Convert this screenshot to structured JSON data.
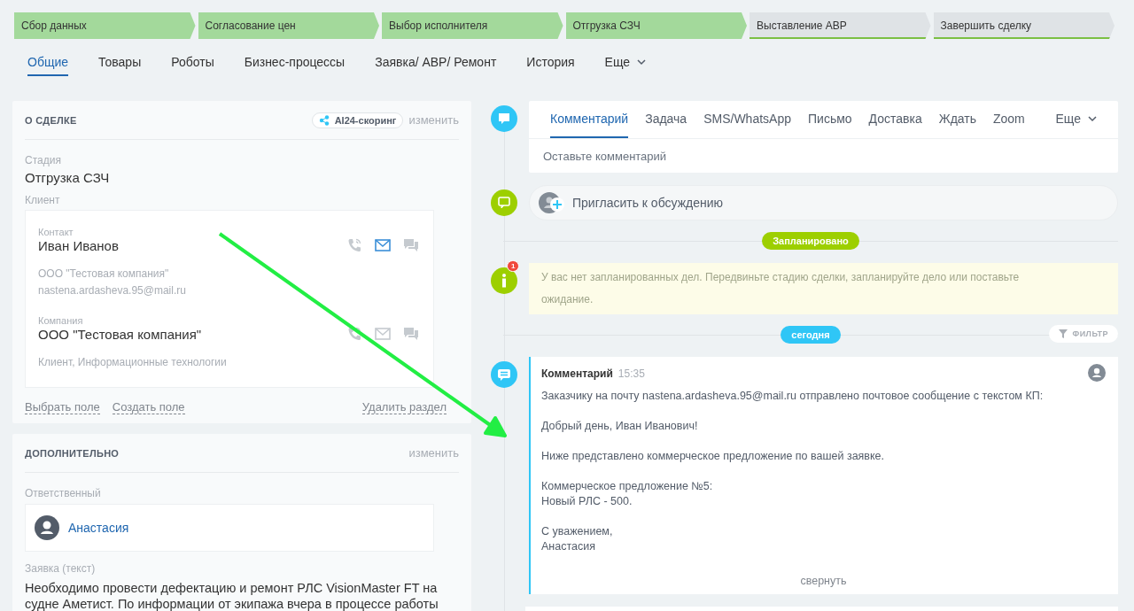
{
  "stages": [
    {
      "label": "Сбор данных",
      "done": true
    },
    {
      "label": "Согласование цен",
      "done": true
    },
    {
      "label": "Выбор исполнителя",
      "done": true
    },
    {
      "label": "Отгрузка СЗЧ",
      "done": true
    },
    {
      "label": "Выставление АВР",
      "done": false
    },
    {
      "label": "Завершить сделку",
      "done": false
    }
  ],
  "tabs": [
    {
      "label": "Общие",
      "selected": true
    },
    {
      "label": "Товары",
      "selected": false
    },
    {
      "label": "Роботы",
      "selected": false
    },
    {
      "label": "Бизнес-процессы",
      "selected": false
    },
    {
      "label": "Заявка/ АВР/ Ремонт",
      "selected": false
    },
    {
      "label": "История",
      "selected": false
    }
  ],
  "tabs_more": "Еще",
  "deal_card": {
    "title": "О СДЕЛКЕ",
    "badge": "AI24-скоринг",
    "edit": "изменить",
    "stage_label": "Стадия",
    "stage_value": "Отгрузка СЗЧ",
    "client_label": "Клиент",
    "clients": [
      {
        "label": "Контакт",
        "name": "Иван Иванов",
        "details": [
          "ООО \"Тестовая компания\"",
          "nastena.ardasheva.95@mail.ru"
        ],
        "email_active": true
      },
      {
        "label": "Компания",
        "name": "ООО \"Тестовая компания\"",
        "details": [
          "Клиент, Информационные технологии"
        ],
        "email_active": false
      }
    ],
    "links": [
      "Выбрать поле",
      "Создать поле"
    ],
    "remove": "Удалить раздел"
  },
  "extra_card": {
    "title": "ДОПОЛНИТЕЛЬНО",
    "edit": "изменить",
    "responsible_label": "Ответственный",
    "responsible": "Анастасия",
    "request_label": "Заявка (текст)",
    "request_text": "Необходимо провести дефектацию и ремонт РЛС VisionMaster FT на судне Аметист. По информации от экипажа вчера в процессе работы"
  },
  "composer": {
    "tabs": [
      {
        "label": "Комментарий",
        "selected": true
      },
      {
        "label": "Задача",
        "selected": false
      },
      {
        "label": "SMS/WhatsApp",
        "selected": false
      },
      {
        "label": "Письмо",
        "selected": false
      },
      {
        "label": "Доставка",
        "selected": false
      },
      {
        "label": "Ждать",
        "selected": false
      },
      {
        "label": "Zoom",
        "selected": false
      }
    ],
    "more": "Еще",
    "placeholder": "Оставьте комментарий"
  },
  "invite": "Пригласить к обсуждению",
  "planned_badge": "Запланировано",
  "notice": {
    "counter": "1",
    "text": "У вас нет запланированных дел. Передвиньте стадию сделки, запланируйте дело или поставьте ожидание."
  },
  "today_badge": "сегодня",
  "filter": "ФИЛЬТР",
  "comment": {
    "title": "Комментарий",
    "time": "15:35",
    "paragraphs": [
      [
        "Заказчику на почту nastena.ardasheva.95@mail.ru отправлено почтовое сообщение с текстом КП:"
      ],
      [
        "Добрый день, Иван Иванович!"
      ],
      [
        "Ниже представлено коммерческое предложение по вашей заявке."
      ],
      [
        "Коммерческое предложение №5:",
        "Новый РЛС - 500."
      ],
      [
        "С уважением,",
        "Анастасия"
      ]
    ],
    "collapse": "свернуть"
  }
}
